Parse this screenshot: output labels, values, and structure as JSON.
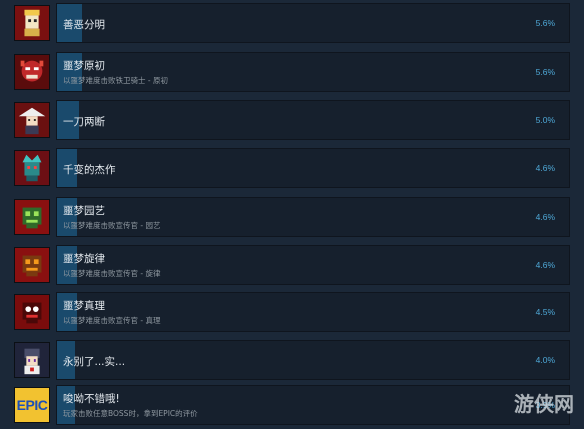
{
  "achievements": [
    {
      "title": "善恶分明",
      "desc": "",
      "percent": "5.6%",
      "ratio": 0.056,
      "icon": "golden-king-icon"
    },
    {
      "title": "噩梦原初",
      "desc": "以噩梦难度击败铁卫骑士 - 原初",
      "percent": "5.6%",
      "ratio": 0.056,
      "icon": "red-demon-icon"
    },
    {
      "title": "一刀两断",
      "desc": "",
      "percent": "5.0%",
      "ratio": 0.05,
      "icon": "straw-hat-samurai-icon"
    },
    {
      "title": "千变的杰作",
      "desc": "",
      "percent": "4.6%",
      "ratio": 0.046,
      "icon": "crowned-mask-icon"
    },
    {
      "title": "噩梦园艺",
      "desc": "以噩梦难度击败宣传官 - 园艺",
      "percent": "4.6%",
      "ratio": 0.046,
      "icon": "green-skull-icon"
    },
    {
      "title": "噩梦旋律",
      "desc": "以噩梦难度击败宣传官 - 旋律",
      "percent": "4.6%",
      "ratio": 0.046,
      "icon": "orange-skull-icon"
    },
    {
      "title": "噩梦真理",
      "desc": "以噩梦难度击败宣传官 - 真理",
      "percent": "4.5%",
      "ratio": 0.045,
      "icon": "red-skull-icon"
    },
    {
      "title": "永别了...实...",
      "desc": "",
      "percent": "4.0%",
      "ratio": 0.04,
      "icon": "maid-girl-icon"
    },
    {
      "title": "唆呦不错哦!",
      "desc": "玩家击败任意BOSS时，拿到EPIC的评价",
      "percent": "3.9%",
      "ratio": 0.039,
      "icon": "epic-badge-icon"
    }
  ],
  "epic_label": "EPIC",
  "watermark": "游侠网"
}
